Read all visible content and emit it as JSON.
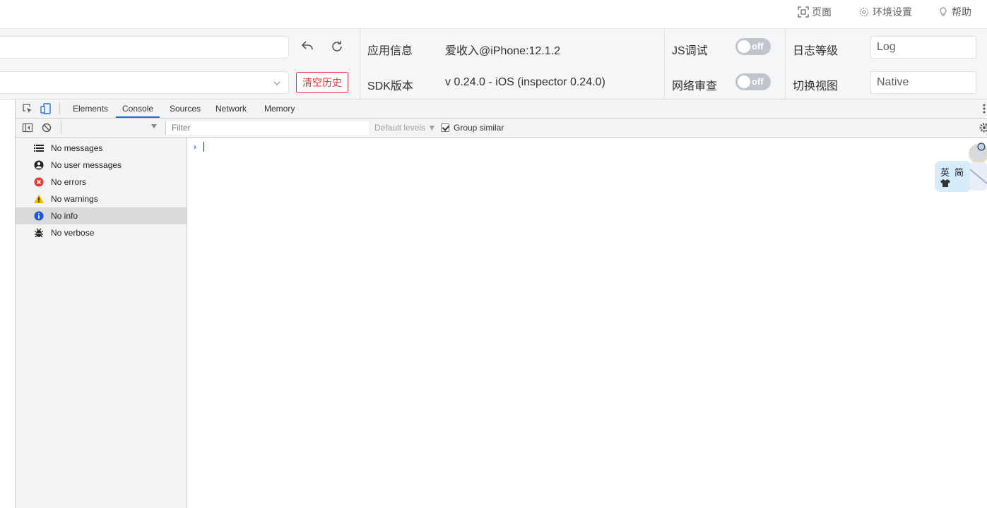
{
  "topnav": {
    "items": [
      {
        "label": "页面",
        "icon": "scan-icon"
      },
      {
        "label": "环境设置",
        "icon": "settings-icon"
      },
      {
        "label": "帮助",
        "icon": "lightbulb-icon"
      }
    ]
  },
  "panel": {
    "url_value": "",
    "history_value": "",
    "clear_history_label": "清空历史",
    "app_info_label": "应用信息",
    "app_info_value": "爱收入@iPhone:12.1.2",
    "sdk_label": "SDK版本",
    "sdk_value": "v 0.24.0 - iOS (inspector 0.24.0)",
    "js_debug_label": "JS调试",
    "js_debug_state": "off",
    "network_label": "网络审查",
    "network_state": "off",
    "log_level_label": "日志等级",
    "log_level_value": "Log",
    "view_label": "切换视图",
    "view_value": "Native"
  },
  "devtools": {
    "tabs": [
      {
        "label": "Elements",
        "active": false
      },
      {
        "label": "Console",
        "active": true
      },
      {
        "label": "Sources",
        "active": false
      },
      {
        "label": "Network",
        "active": false
      },
      {
        "label": "Memory",
        "active": false
      }
    ],
    "filter_placeholder": "Filter",
    "levels_label": "Default levels ▼",
    "group_similar_label": "Group similar",
    "group_similar_checked": true,
    "sidebar": [
      {
        "label": "No messages",
        "icon": "list-icon"
      },
      {
        "label": "No user messages",
        "icon": "user-icon"
      },
      {
        "label": "No errors",
        "icon": "error-icon"
      },
      {
        "label": "No warnings",
        "icon": "warning-icon"
      },
      {
        "label": "No info",
        "icon": "info-icon",
        "active": true
      },
      {
        "label": "No verbose",
        "icon": "bug-icon"
      }
    ],
    "prompt_symbol": "›"
  },
  "widget": {
    "lang_en": "英",
    "lang_zh": "简"
  },
  "colors": {
    "accent_blue": "#1a73e8",
    "danger_red": "#e4393c",
    "toggle_off": "#c0c4cc"
  }
}
